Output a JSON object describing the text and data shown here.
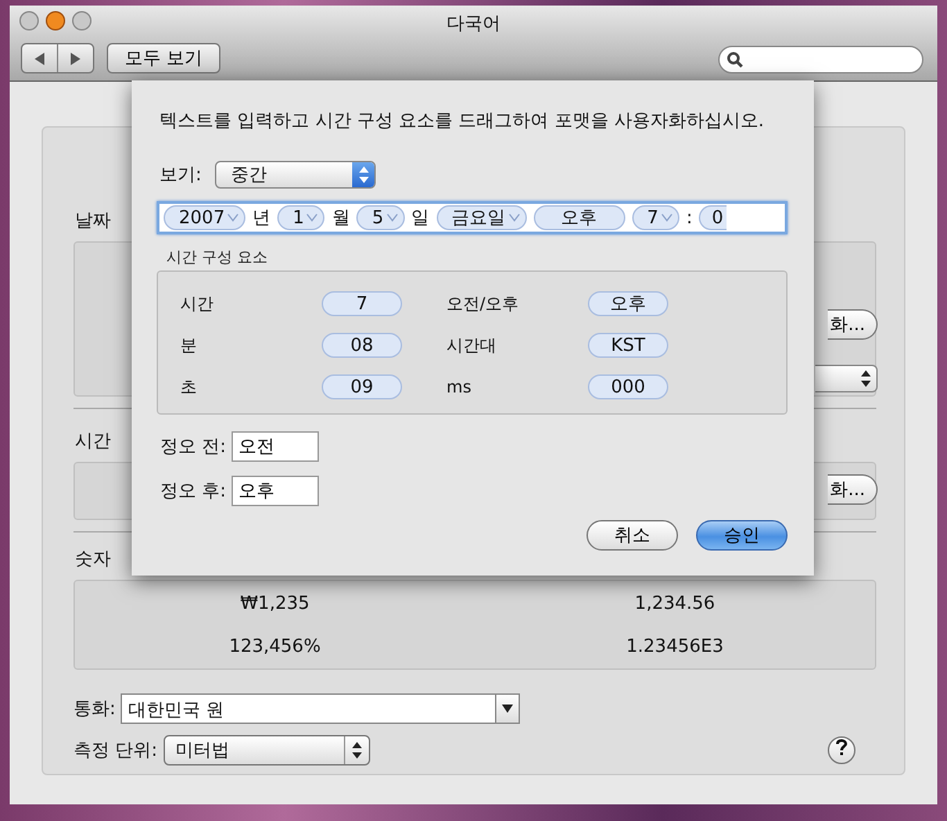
{
  "window": {
    "title": "다국어",
    "show_all_button": "모두 보기"
  },
  "date_section": {
    "title": "날짜",
    "customize_button": "화..."
  },
  "time_section": {
    "title": "시간",
    "customize_button": "화..."
  },
  "numbers_section": {
    "title": "숫자",
    "values": [
      "₩1,235",
      "1,234.56",
      "123,456%",
      "1.23456E3"
    ]
  },
  "currency": {
    "label": "통화:",
    "value": "대한민국 원"
  },
  "measurement": {
    "label": "측정 단위:",
    "value": "미터법"
  },
  "sheet": {
    "instruction": "텍스트를 입력하고 시간 구성 요소를 드래그하여 포맷을 사용자화하십시오.",
    "view": {
      "label": "보기:",
      "value": "중간"
    },
    "format_tokens": [
      {
        "text": "2007",
        "kind": "dropdown"
      },
      {
        "text": "년",
        "kind": "literal"
      },
      {
        "text": "1",
        "kind": "dropdown"
      },
      {
        "text": "월",
        "kind": "literal"
      },
      {
        "text": "5",
        "kind": "dropdown"
      },
      {
        "text": "일",
        "kind": "literal"
      },
      {
        "text": "금요일",
        "kind": "dropdown"
      },
      {
        "text": "오후",
        "kind": "token"
      },
      {
        "text": "7",
        "kind": "dropdown"
      },
      {
        "text": ":",
        "kind": "literal"
      },
      {
        "text": "0",
        "kind": "cut"
      }
    ],
    "components_title": "시간 구성 요소",
    "components": [
      {
        "label": "시간",
        "value": "7"
      },
      {
        "label": "오전/오후",
        "value": "오후"
      },
      {
        "label": "분",
        "value": "08"
      },
      {
        "label": "시간대",
        "value": "KST"
      },
      {
        "label": "초",
        "value": "09"
      },
      {
        "label": "ms",
        "value": "000"
      }
    ],
    "am_field": {
      "label": "정오 전:",
      "value": "오전"
    },
    "pm_field": {
      "label": "정오 후:",
      "value": "오후"
    },
    "buttons": [
      {
        "label": "취소",
        "default": false
      },
      {
        "label": "승인",
        "default": true
      }
    ]
  }
}
